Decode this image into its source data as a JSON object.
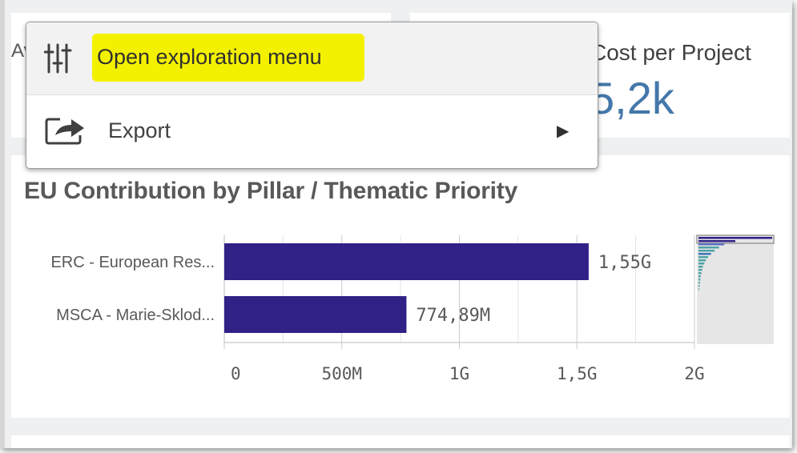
{
  "kpi_left": {
    "title": "Av",
    "value": ""
  },
  "kpi_right": {
    "title": "Cost per Project",
    "value": "5,2k"
  },
  "menu": {
    "items": [
      {
        "label": "Open exploration menu",
        "icon": "sliders-icon"
      },
      {
        "label": "Export",
        "icon": "export-icon",
        "submenu_arrow": "▶"
      }
    ]
  },
  "chart_title": "EU Contribution by Pillar / Thematic Priority",
  "colors": {
    "bar": "#2f2186",
    "kpi_value": "#4477aa",
    "highlight": "#f4f100"
  },
  "chart_data": {
    "type": "bar",
    "orientation": "horizontal",
    "categories": [
      "ERC - European Res...",
      "MSCA - Marie-Sklod..."
    ],
    "values": [
      1550000000,
      774890000
    ],
    "data_labels": [
      "1,55G",
      "774,89M"
    ],
    "x_ticks": [
      0,
      500000000,
      1000000000,
      1500000000,
      2000000000
    ],
    "x_tick_labels": [
      "0",
      "500M",
      "1G",
      "1,5G",
      "2G"
    ],
    "xlim": [
      0,
      2000000000
    ],
    "grid": true,
    "minimap_values": [
      1.0,
      0.5,
      0.35,
      0.28,
      0.22,
      0.17,
      0.13,
      0.1,
      0.08,
      0.06,
      0.05,
      0.04,
      0.03,
      0.025,
      0.02,
      0.015,
      0.01
    ]
  }
}
